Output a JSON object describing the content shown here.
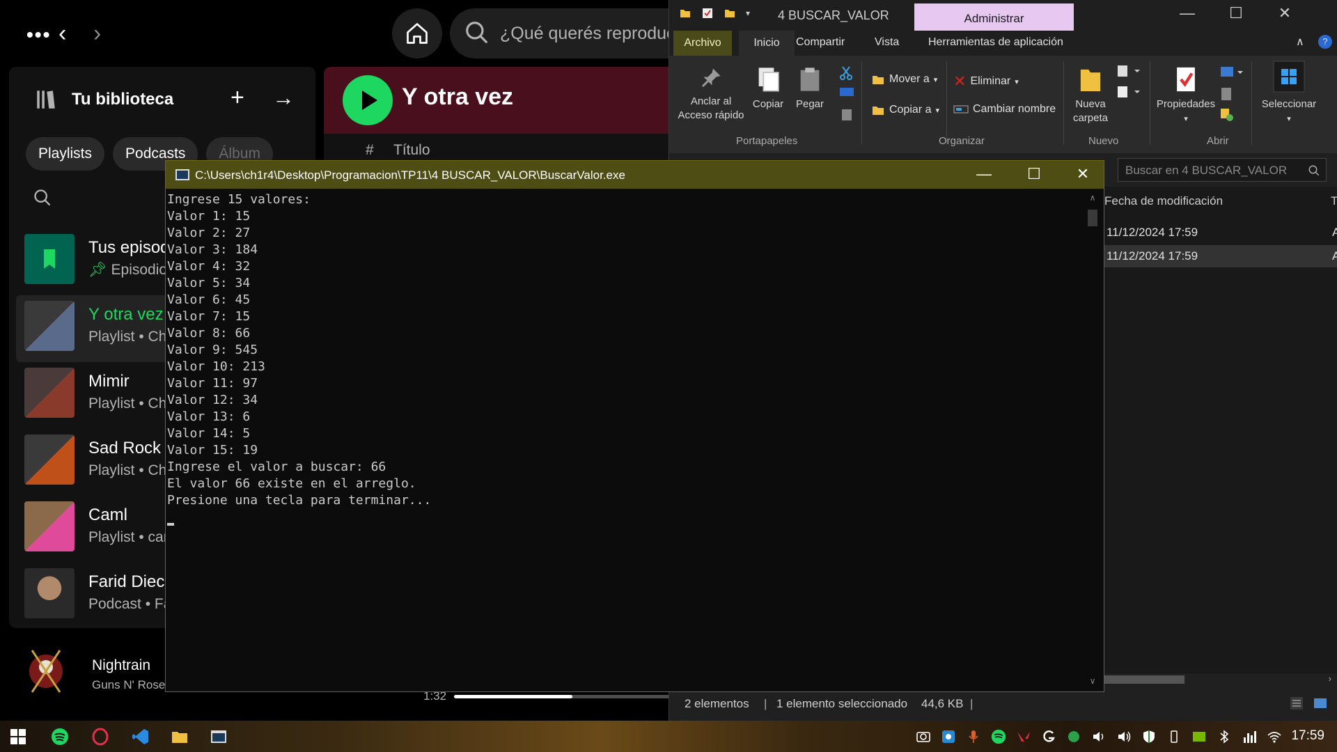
{
  "spotify": {
    "search_placeholder": "¿Qué querés reproduc",
    "library": {
      "title": "Tu biblioteca",
      "chips": [
        "Playlists",
        "Podcasts",
        "Álbum"
      ],
      "items": [
        {
          "name": "Tus episod",
          "sub": "Episodios"
        },
        {
          "name": "Y otra vez",
          "sub": "Playlist • Chi"
        },
        {
          "name": "Mimir",
          "sub": "Playlist • Chi"
        },
        {
          "name": "Sad Rock",
          "sub": "Playlist • Chi"
        },
        {
          "name": "Caml",
          "sub": "Playlist • car"
        },
        {
          "name": "Farid Diecl",
          "sub": "Podcast • Fa"
        }
      ]
    },
    "main": {
      "title": "Y otra vez",
      "col_hash": "#",
      "col_title": "Título"
    },
    "player": {
      "title": "Nightrain",
      "artist": "Guns N' Rose",
      "time": "1:32",
      "progress": 0.34
    }
  },
  "explorer": {
    "title": "4 BUSCAR_VALOR",
    "admin_tab": "Administrar",
    "tabs": [
      "Archivo",
      "Inicio",
      "Compartir",
      "Vista",
      "Herramientas de aplicación"
    ],
    "ribbon": {
      "pin_line1": "Anclar al",
      "pin_line2": "Acceso rápido",
      "copy": "Copiar",
      "paste": "Pegar",
      "move_to": "Mover a",
      "copy_to": "Copiar a",
      "delete": "Eliminar",
      "rename": "Cambiar nombre",
      "new_folder_line1": "Nueva",
      "new_folder_line2": "carpeta",
      "properties": "Propiedades",
      "select": "Seleccionar",
      "group_clipboard": "Portapapeles",
      "group_organize": "Organizar",
      "group_new": "Nuevo",
      "group_open": "Abrir"
    },
    "search_placeholder": "Buscar en 4 BUSCAR_VALOR",
    "column_date": "Fecha de modificación",
    "column_type": "T",
    "rows": [
      {
        "date": "11/12/2024 17:59",
        "suffix": "A"
      },
      {
        "date": "11/12/2024 17:59",
        "suffix": "A"
      }
    ],
    "status": {
      "count": "2 elementos",
      "selected": "1 elemento seleccionado",
      "size": "44,6 KB"
    }
  },
  "console": {
    "title": "C:\\Users\\ch1r4\\Desktop\\Programacion\\TP11\\4 BUSCAR_VALOR\\BuscarValor.exe",
    "lines": [
      "Ingrese 15 valores:",
      "Valor 1: 15",
      "Valor 2: 27",
      "Valor 3: 184",
      "Valor 4: 32",
      "Valor 5: 34",
      "Valor 6: 45",
      "Valor 7: 15",
      "Valor 8: 66",
      "Valor 9: 545",
      "Valor 10: 213",
      "Valor 11: 97",
      "Valor 12: 34",
      "Valor 13: 6",
      "Valor 14: 5",
      "Valor 15: 19",
      "Ingrese el valor a buscar: 66",
      "El valor 66 existe en el arreglo.",
      "Presione una tecla para terminar..."
    ]
  },
  "taskbar": {
    "time": "17:59",
    "icons": [
      "windows-icon",
      "spotify-icon",
      "opera-icon",
      "vscode-icon",
      "file-explorer-icon",
      "console-icon"
    ]
  }
}
